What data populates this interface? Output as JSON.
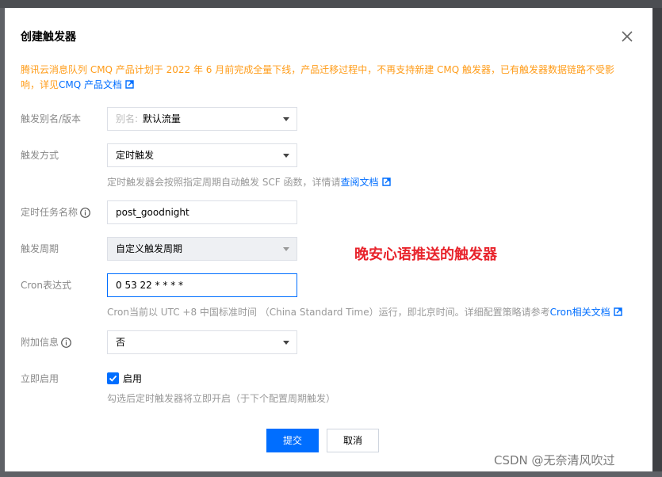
{
  "dialog": {
    "title": "创建触发器",
    "notice_text": "腾讯云消息队列 CMQ 产品计划于 2022 年 6 月前完成全量下线，产品迁移过程中，不再支持新建 CMQ 触发器，已有触发器数据链路不受影响，详见",
    "notice_link": "CMQ 产品文档"
  },
  "form": {
    "alias": {
      "label": "触发别名/版本",
      "prefix": "别名:",
      "value": "默认流量"
    },
    "trigger_type": {
      "label": "触发方式",
      "value": "定时触发",
      "hint_text": "定时触发器会按照指定周期自动触发 SCF 函数，详情请",
      "hint_link": "查阅文档"
    },
    "task_name": {
      "label": "定时任务名称",
      "value": "post_goodnight"
    },
    "period": {
      "label": "触发周期",
      "value": "自定义触发周期"
    },
    "cron": {
      "label": "Cron表达式",
      "value": "0 53 22 * * * *",
      "hint_text": "Cron当前以 UTC +8 中国标准时间 （China Standard Time）运行，即北京时间。详细配置策略请参考",
      "hint_link": "Cron相关文档"
    },
    "extra_info": {
      "label": "附加信息",
      "value": "否"
    },
    "enable_now": {
      "label": "立即启用",
      "checkbox_label": "启用",
      "checked": true,
      "hint_text": "勾选后定时触发器将立即开启（于下个配置周期触发）"
    }
  },
  "annotation": "晚安心语推送的触发器",
  "buttons": {
    "submit": "提交",
    "cancel": "取消"
  },
  "watermark": "CSDN @无奈清风吹过",
  "colors": {
    "primary": "#006eff",
    "notice": "#ff9c19",
    "annotation": "#e8232b"
  }
}
